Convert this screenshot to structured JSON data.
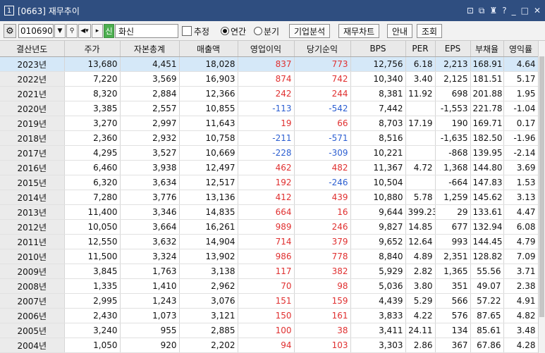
{
  "window": {
    "number": "1",
    "title": "[0663] 재무추이",
    "controls": [
      "⊡",
      "⧉",
      "♜",
      "?",
      "_",
      "□",
      "✕"
    ]
  },
  "toolbar": {
    "code": "010690",
    "stock_badge": "신",
    "stock_name": "화신",
    "estimate_label": "추정",
    "radio_yearly": "연간",
    "radio_quarterly": "분기",
    "btn_company": "기업분석",
    "btn_chart": "재무차트",
    "btn_guide": "안내",
    "btn_query": "조회"
  },
  "table": {
    "headers": [
      "결산년도",
      "주가",
      "자본총계",
      "매출액",
      "영업이익",
      "당기순익",
      "BPS",
      "PER",
      "EPS",
      "부채율",
      "영익률"
    ],
    "rows": [
      [
        "2023년",
        "13,680",
        "4,451",
        "18,028",
        "837",
        "773",
        "12,756",
        "6.18",
        "2,213",
        "168.91",
        "4.64"
      ],
      [
        "2022년",
        "7,220",
        "3,569",
        "16,903",
        "874",
        "742",
        "10,340",
        "3.40",
        "2,125",
        "181.51",
        "5.17"
      ],
      [
        "2021년",
        "8,320",
        "2,884",
        "12,366",
        "242",
        "244",
        "8,381",
        "11.92",
        "698",
        "201.88",
        "1.95"
      ],
      [
        "2020년",
        "3,385",
        "2,557",
        "10,855",
        "-113",
        "-542",
        "7,442",
        "",
        "-1,553",
        "221.78",
        "-1.04"
      ],
      [
        "2019년",
        "3,270",
        "2,997",
        "11,643",
        "19",
        "66",
        "8,703",
        "17.19",
        "190",
        "169.71",
        "0.17"
      ],
      [
        "2018년",
        "2,360",
        "2,932",
        "10,758",
        "-211",
        "-571",
        "8,516",
        "",
        "-1,635",
        "182.50",
        "-1.96"
      ],
      [
        "2017년",
        "4,295",
        "3,527",
        "10,669",
        "-228",
        "-309",
        "10,221",
        "",
        "-868",
        "139.95",
        "-2.14"
      ],
      [
        "2016년",
        "6,460",
        "3,938",
        "12,497",
        "462",
        "482",
        "11,367",
        "4.72",
        "1,368",
        "144.80",
        "3.69"
      ],
      [
        "2015년",
        "6,320",
        "3,634",
        "12,517",
        "192",
        "-246",
        "10,504",
        "",
        "-664",
        "147.83",
        "1.53"
      ],
      [
        "2014년",
        "7,280",
        "3,776",
        "13,136",
        "412",
        "439",
        "10,880",
        "5.78",
        "1,259",
        "145.62",
        "3.13"
      ],
      [
        "2013년",
        "11,400",
        "3,346",
        "14,835",
        "664",
        "16",
        "9,644",
        "399.23",
        "29",
        "133.61",
        "4.47"
      ],
      [
        "2012년",
        "10,050",
        "3,664",
        "16,261",
        "989",
        "246",
        "9,827",
        "14.85",
        "677",
        "132.94",
        "6.08"
      ],
      [
        "2011년",
        "12,550",
        "3,632",
        "14,904",
        "714",
        "379",
        "9,652",
        "12.64",
        "993",
        "144.45",
        "4.79"
      ],
      [
        "2010년",
        "11,500",
        "3,324",
        "13,902",
        "986",
        "778",
        "8,840",
        "4.89",
        "2,351",
        "128.82",
        "7.09"
      ],
      [
        "2009년",
        "3,845",
        "1,763",
        "3,138",
        "117",
        "382",
        "5,929",
        "2.82",
        "1,365",
        "55.56",
        "3.71"
      ],
      [
        "2008년",
        "1,335",
        "1,410",
        "2,962",
        "70",
        "98",
        "5,036",
        "3.80",
        "351",
        "49.07",
        "2.38"
      ],
      [
        "2007년",
        "2,995",
        "1,243",
        "3,076",
        "151",
        "159",
        "4,439",
        "5.29",
        "566",
        "57.22",
        "4.91"
      ],
      [
        "2006년",
        "2,430",
        "1,073",
        "3,121",
        "150",
        "161",
        "3,833",
        "4.22",
        "576",
        "87.65",
        "4.82"
      ],
      [
        "2005년",
        "3,240",
        "955",
        "2,885",
        "100",
        "38",
        "3,411",
        "24.11",
        "134",
        "85.61",
        "3.48"
      ],
      [
        "2004년",
        "1,050",
        "920",
        "2,202",
        "94",
        "103",
        "3,303",
        "2.86",
        "367",
        "67.86",
        "4.28"
      ]
    ],
    "colors": {
      "positive": "#e03030",
      "negative": "#2d5fd1",
      "selected_row": "#d5e8f8"
    }
  }
}
